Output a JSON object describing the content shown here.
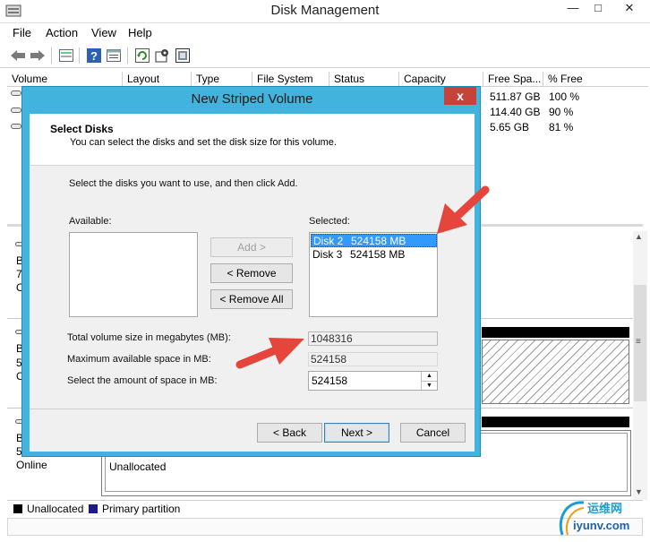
{
  "window": {
    "title": "Disk Management",
    "controls": {
      "minimize": "—",
      "maximize": "□",
      "close": "✕"
    }
  },
  "menu": [
    "File",
    "Action",
    "View",
    "Help"
  ],
  "toolbar_icons": [
    "back-arrow-icon",
    "forward-arrow-icon",
    "disk-list-icon",
    "help-icon",
    "properties-icon",
    "refresh-icon",
    "settings-icon",
    "rescan-icon"
  ],
  "volume_list": {
    "columns": [
      "Volume",
      "Layout",
      "Type",
      "File System",
      "Status",
      "Capacity",
      "Free Spa...",
      "% Free"
    ],
    "rows": [
      {
        "free": "511.87 GB",
        "pct": "100 %"
      },
      {
        "free": "114.40 GB",
        "pct": "90 %"
      },
      {
        "free": "5.65 GB",
        "pct": "81 %"
      }
    ]
  },
  "disk_panes": [
    {
      "line1": "B",
      "line2": "7",
      "line3": "O"
    },
    {
      "line1": "B",
      "line2": "5",
      "line3": "O"
    },
    {
      "line1": "B",
      "line2": "5",
      "line3": "Online",
      "partition": "Unallocated"
    }
  ],
  "legend": [
    {
      "label": "Unallocated",
      "color": "#000000"
    },
    {
      "label": "Primary partition",
      "color": "#1a1a8a"
    }
  ],
  "dialog": {
    "title": "New Striped Volume",
    "close": "x",
    "header_title": "Select Disks",
    "header_subtitle": "You can select the disks and set the disk size for this volume.",
    "instruction": "Select the disks you want to use, and then click Add.",
    "available_label": "Available:",
    "selected_label": "Selected:",
    "selected_items": [
      {
        "disk": "Disk 2",
        "size": "524158 MB"
      },
      {
        "disk": "Disk 3",
        "size": "524158 MB"
      }
    ],
    "add_label": "Add >",
    "remove_label": "< Remove",
    "remove_all_label": "< Remove All",
    "total_label": "Total volume size in megabytes (MB):",
    "total_value": "1048316",
    "max_label": "Maximum available space in MB:",
    "max_value": "524158",
    "amount_label": "Select the amount of space in MB:",
    "amount_value": "524158",
    "back_label": "< Back",
    "next_label": "Next >",
    "cancel_label": "Cancel"
  },
  "watermark": {
    "text": "运维网",
    "url_text": "iyunv.com"
  },
  "colors": {
    "dialog_frame": "#41b3dd",
    "annotation_arrow": "#e5453a",
    "selection": "#3399ff"
  }
}
